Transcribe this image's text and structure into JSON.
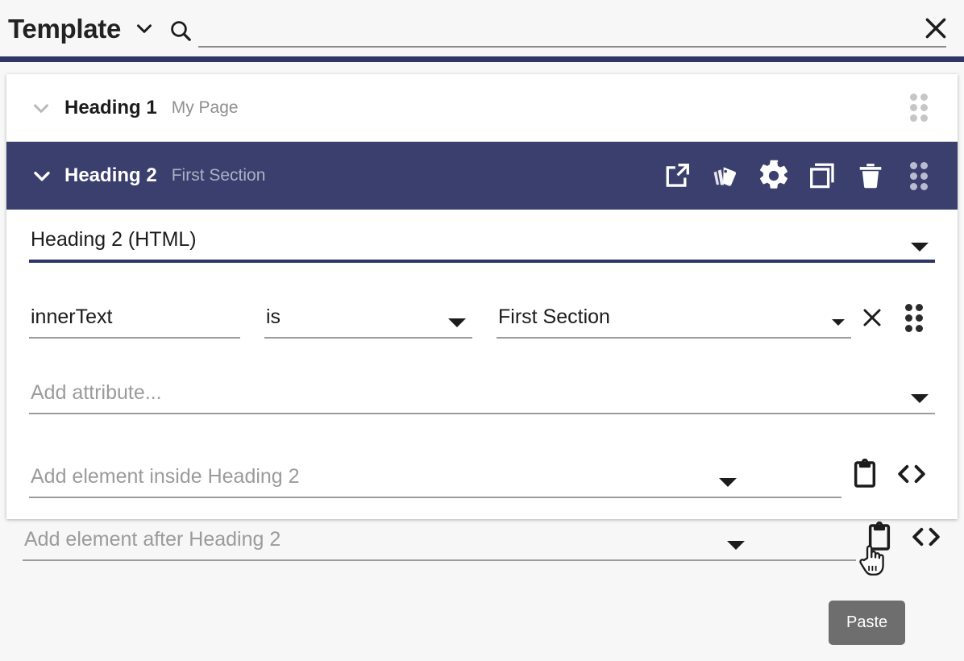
{
  "header": {
    "title": "Template",
    "title_caret_icon": "chevron-down-icon",
    "search_icon": "search-icon",
    "search_value": "",
    "search_placeholder": "",
    "close_icon": "close-icon",
    "accent_color": "#2f3566"
  },
  "tree": {
    "nodes": [
      {
        "caret_icon": "chevron-down-icon",
        "label": "Heading 1",
        "sub": "My Page",
        "selected": false,
        "drag_icon": "drag-handle-icon"
      },
      {
        "caret_icon": "chevron-down-icon",
        "label": "Heading 2",
        "sub": "First Section",
        "selected": true,
        "drag_icon": "drag-handle-icon",
        "actions": [
          {
            "name": "open-in-new-icon",
            "label": "Open in new"
          },
          {
            "name": "style-palette-icon",
            "label": "Styles"
          },
          {
            "name": "gear-icon",
            "label": "Settings"
          },
          {
            "name": "copy-icon",
            "label": "Copy"
          },
          {
            "name": "trash-icon",
            "label": "Delete"
          },
          {
            "name": "drag-handle-icon",
            "label": "Reorder"
          }
        ]
      }
    ]
  },
  "editor": {
    "element_type": {
      "value": "Heading 2 (HTML)",
      "caret_icon": "chevron-down-icon",
      "underline_color": "#2f3566"
    },
    "attribute": {
      "name": "innerText",
      "operator": "is",
      "operator_caret_icon": "chevron-down-icon",
      "value": "First Section",
      "value_caret_icon": "chevron-down-icon",
      "remove_icon": "close-icon",
      "drag_icon": "drag-handle-icon"
    },
    "add_attribute": {
      "placeholder": "Add attribute...",
      "caret_icon": "chevron-down-icon"
    },
    "add_element_inside": {
      "placeholder": "Add element inside Heading 2",
      "caret_icon": "chevron-down-icon",
      "paste_icon": "clipboard-paste-icon",
      "code_icon": "code-brackets-icon"
    }
  },
  "add_element_after": {
    "placeholder": "Add element after Heading 2",
    "caret_icon": "chevron-down-icon",
    "paste_icon": "clipboard-paste-icon",
    "code_icon": "code-brackets-icon"
  },
  "tooltip": {
    "text": "Paste",
    "background": "#6e6e6e"
  },
  "cursor": {
    "icon": "pointing-hand-cursor"
  }
}
